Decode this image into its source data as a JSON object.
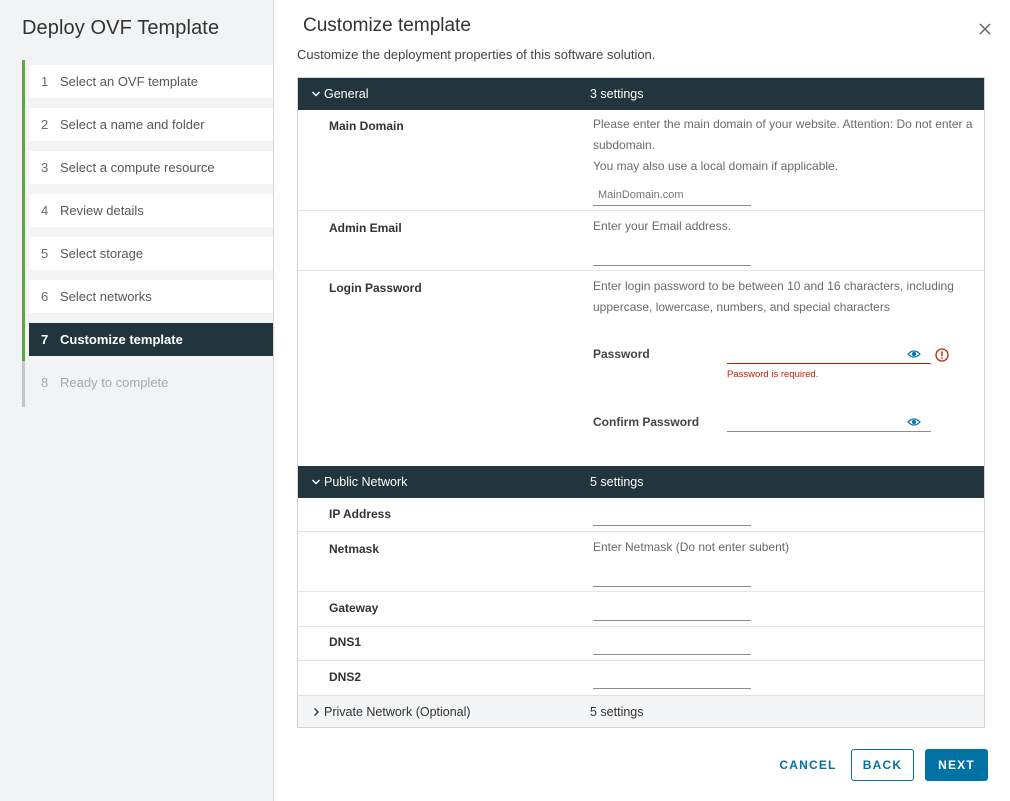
{
  "sidebar": {
    "title": "Deploy OVF Template",
    "steps": [
      {
        "num": "1",
        "label": "Select an OVF template"
      },
      {
        "num": "2",
        "label": "Select a name and folder"
      },
      {
        "num": "3",
        "label": "Select a compute resource"
      },
      {
        "num": "4",
        "label": "Review details"
      },
      {
        "num": "5",
        "label": "Select storage"
      },
      {
        "num": "6",
        "label": "Select networks"
      },
      {
        "num": "7",
        "label": "Customize template"
      },
      {
        "num": "8",
        "label": "Ready to complete"
      }
    ]
  },
  "main": {
    "title": "Customize template",
    "subtitle": "Customize the deployment properties of this software solution."
  },
  "sections": {
    "general": {
      "name": "General",
      "count": "3 settings",
      "main_domain": {
        "label": "Main Domain",
        "desc1": "Please enter the main domain of your website. Attention: Do not enter a subdomain.",
        "desc2": "You may also use a local domain if applicable.",
        "placeholder": "MainDomain.com",
        "value": ""
      },
      "admin_email": {
        "label": "Admin Email",
        "desc": "Enter your Email address.",
        "value": ""
      },
      "login_password": {
        "label": "Login Password",
        "desc": "Enter login password to be between 10 and 16 characters, including uppercase, lowercase, numbers, and special characters",
        "password_label": "Password",
        "password_error": "Password is required.",
        "confirm_label": "Confirm Password"
      }
    },
    "public_network": {
      "name": "Public Network",
      "count": "5 settings",
      "ip_label": "IP Address",
      "netmask_label": "Netmask",
      "netmask_desc": "Enter Netmask (Do not enter subent)",
      "gateway_label": "Gateway",
      "dns1_label": "DNS1",
      "dns2_label": "DNS2"
    },
    "private_network": {
      "name": "Private Network (Optional)",
      "count": "5 settings"
    }
  },
  "footer": {
    "cancel": "CANCEL",
    "back": "BACK",
    "next": "NEXT"
  },
  "colors": {
    "accent": "#0072a3",
    "header_dark": "#22343c",
    "error": "#c92100",
    "step_done": "#61a640"
  },
  "icons": {
    "close": "close-icon",
    "chevron_down": "chevron-down-icon",
    "chevron_right": "chevron-right-icon",
    "eye": "eye-icon",
    "error": "error-icon"
  }
}
